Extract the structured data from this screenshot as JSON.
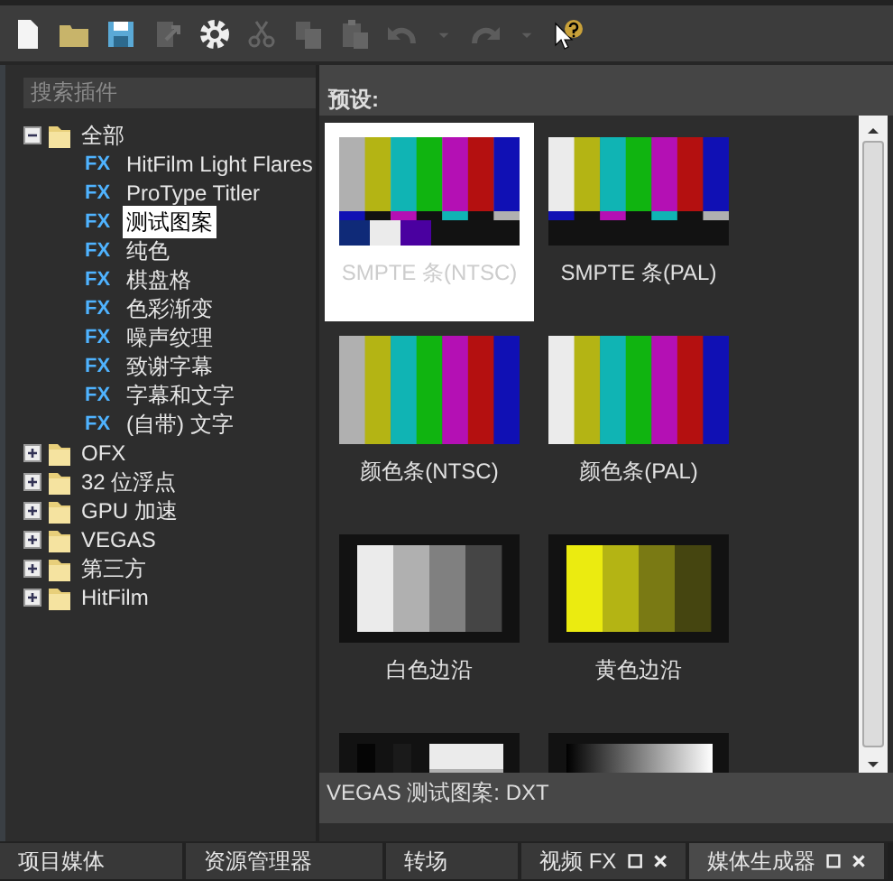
{
  "toolbar": [
    {
      "kind": "new",
      "disabled": false
    },
    {
      "kind": "open",
      "disabled": false
    },
    {
      "kind": "save",
      "disabled": false
    },
    {
      "kind": "export",
      "disabled": true
    },
    {
      "kind": "settings",
      "disabled": false
    },
    {
      "kind": "cut",
      "disabled": true
    },
    {
      "kind": "copy",
      "disabled": true
    },
    {
      "kind": "paste",
      "disabled": true
    },
    {
      "kind": "undo",
      "disabled": true
    },
    {
      "kind": "dropdown",
      "disabled": true
    },
    {
      "kind": "redo",
      "disabled": true
    },
    {
      "kind": "dropdown",
      "disabled": true
    },
    {
      "kind": "help",
      "disabled": false
    }
  ],
  "search": {
    "placeholder": "搜索插件"
  },
  "tree": [
    {
      "label": "全部",
      "expanded": true,
      "selected": false,
      "children": [
        {
          "label": "HitFilm Light Flares",
          "tag": "FX",
          "selected": false
        },
        {
          "label": "ProType Titler",
          "tag": "FX",
          "selected": false
        },
        {
          "label": "测试图案",
          "tag": "FX",
          "selected": true
        },
        {
          "label": "纯色",
          "tag": "FX",
          "selected": false
        },
        {
          "label": "棋盘格",
          "tag": "FX",
          "selected": false
        },
        {
          "label": "色彩渐变",
          "tag": "FX",
          "selected": false
        },
        {
          "label": "噪声纹理",
          "tag": "FX",
          "selected": false
        },
        {
          "label": "致谢字幕",
          "tag": "FX",
          "selected": false
        },
        {
          "label": "字幕和文字",
          "tag": "FX",
          "selected": false
        },
        {
          "label": "(自带) 文字",
          "tag": "FX",
          "selected": false
        }
      ]
    },
    {
      "label": "OFX",
      "expanded": false,
      "selected": false
    },
    {
      "label": "32 位浮点",
      "expanded": false,
      "selected": false
    },
    {
      "label": "GPU 加速",
      "expanded": false,
      "selected": false
    },
    {
      "label": "VEGAS",
      "expanded": false,
      "selected": false
    },
    {
      "label": "第三方",
      "expanded": false,
      "selected": false
    },
    {
      "label": "HitFilm",
      "expanded": false,
      "selected": false
    }
  ],
  "presets_title": "预设:",
  "presets": [
    {
      "kind": "smpte-ntsc",
      "label": "SMPTE 条(NTSC)",
      "selected": true
    },
    {
      "kind": "smpte-pal",
      "label": "SMPTE 条(PAL)",
      "selected": false
    },
    {
      "kind": "bars-ntsc",
      "label": "颜色条(NTSC)",
      "selected": false
    },
    {
      "kind": "bars-pal",
      "label": "颜色条(PAL)",
      "selected": false
    },
    {
      "kind": "white-edge",
      "label": "白色边沿",
      "selected": false
    },
    {
      "kind": "yellow-edge",
      "label": "黄色边沿",
      "selected": false
    },
    {
      "kind": "gray-steps",
      "selected": false
    },
    {
      "kind": "gradient",
      "selected": false
    }
  ],
  "description": "VEGAS 测试图案: DXT",
  "tabs": [
    {
      "label": "项目媒体",
      "selected": false,
      "closable": false
    },
    {
      "label": "资源管理器",
      "selected": false,
      "closable": false
    },
    {
      "label": "转场",
      "selected": false,
      "closable": false
    },
    {
      "label": "视频 FX",
      "selected": false,
      "closable": true
    },
    {
      "label": "媒体生成器",
      "selected": true,
      "closable": true
    }
  ]
}
